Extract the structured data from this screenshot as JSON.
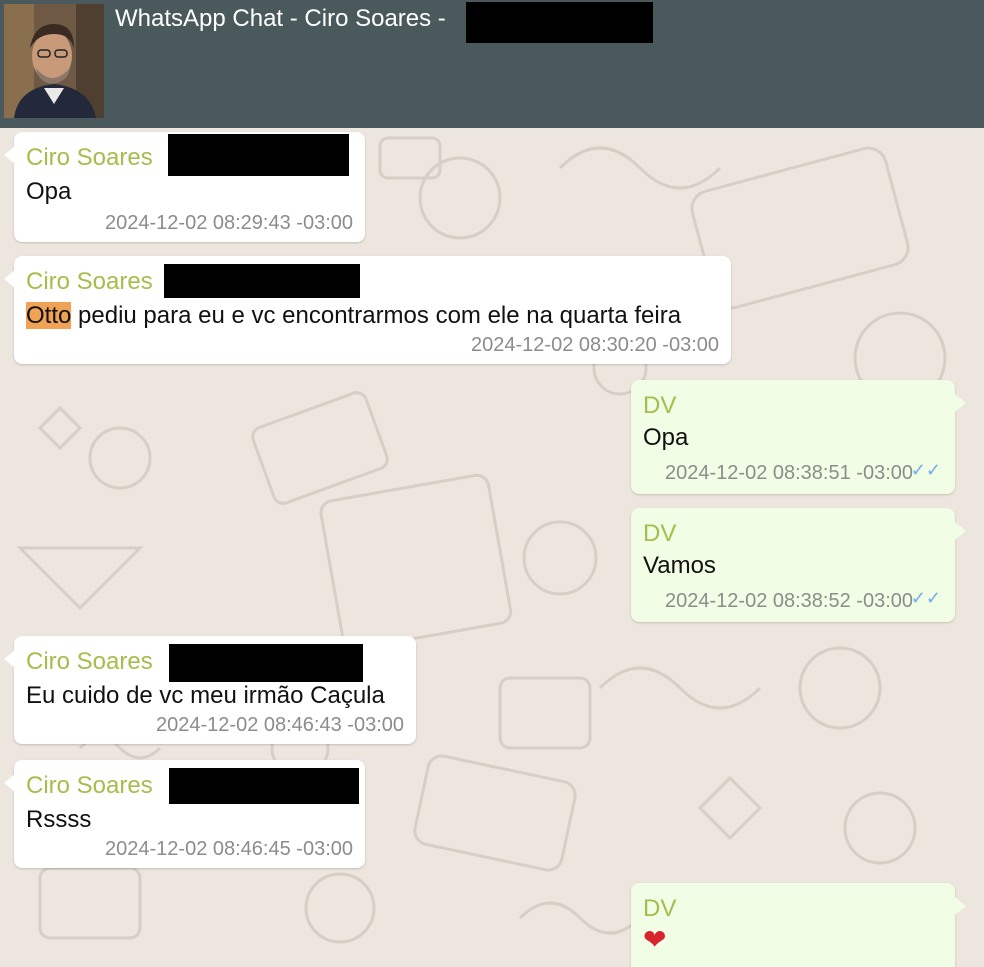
{
  "header": {
    "title": "WhatsApp Chat - Ciro Soares -"
  },
  "messages": [
    {
      "sender": "Ciro Soares",
      "text": "Opa",
      "time": "2024-12-02 08:29:43 -03:00",
      "direction": "in"
    },
    {
      "sender": "Ciro Soares",
      "highlight": "Otto",
      "text_rest": " pediu para eu e vc encontrarmos com ele na quarta feira",
      "time": "2024-12-02 08:30:20 -03:00",
      "direction": "in"
    },
    {
      "sender": "DV",
      "text": "Opa",
      "time": "2024-12-02 08:38:51 -03:00",
      "direction": "out",
      "status": "read"
    },
    {
      "sender": "DV",
      "text": "Vamos",
      "time": "2024-12-02 08:38:52 -03:00",
      "direction": "out",
      "status": "read"
    },
    {
      "sender": "Ciro Soares",
      "text": "Eu cuido de vc meu irmão Caçula",
      "time": "2024-12-02 08:46:43 -03:00",
      "direction": "in"
    },
    {
      "sender": "Ciro Soares",
      "text": "Rssss",
      "time": "2024-12-02 08:46:45 -03:00",
      "direction": "in"
    },
    {
      "sender": "DV",
      "text": "❤",
      "direction": "out"
    }
  ],
  "icons": {
    "read_receipt": "double-check-icon",
    "heart": "heart-icon"
  },
  "colors": {
    "header_bg": "#4a5a5c",
    "sender_name": "#a5bd4b",
    "outgoing_bubble": "#f1fde5",
    "incoming_bubble": "#ffffff",
    "highlight": "#f0a255",
    "read_tick": "#6cb2e6"
  }
}
